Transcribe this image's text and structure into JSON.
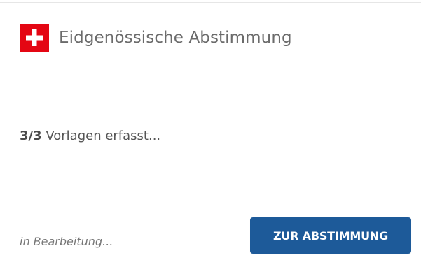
{
  "header": {
    "flag_icon": "swiss-flag-icon",
    "title": "Eidgenössische Abstimmung"
  },
  "status": {
    "count": "3/3",
    "text": " Vorlagen erfasst..."
  },
  "footer": {
    "note": "in Bearbeitung...",
    "button_label": "ZUR ABSTIMMUNG"
  },
  "colors": {
    "flag_red": "#e40613",
    "button_blue": "#1d5a99",
    "title_gray": "#6b6b6b"
  }
}
